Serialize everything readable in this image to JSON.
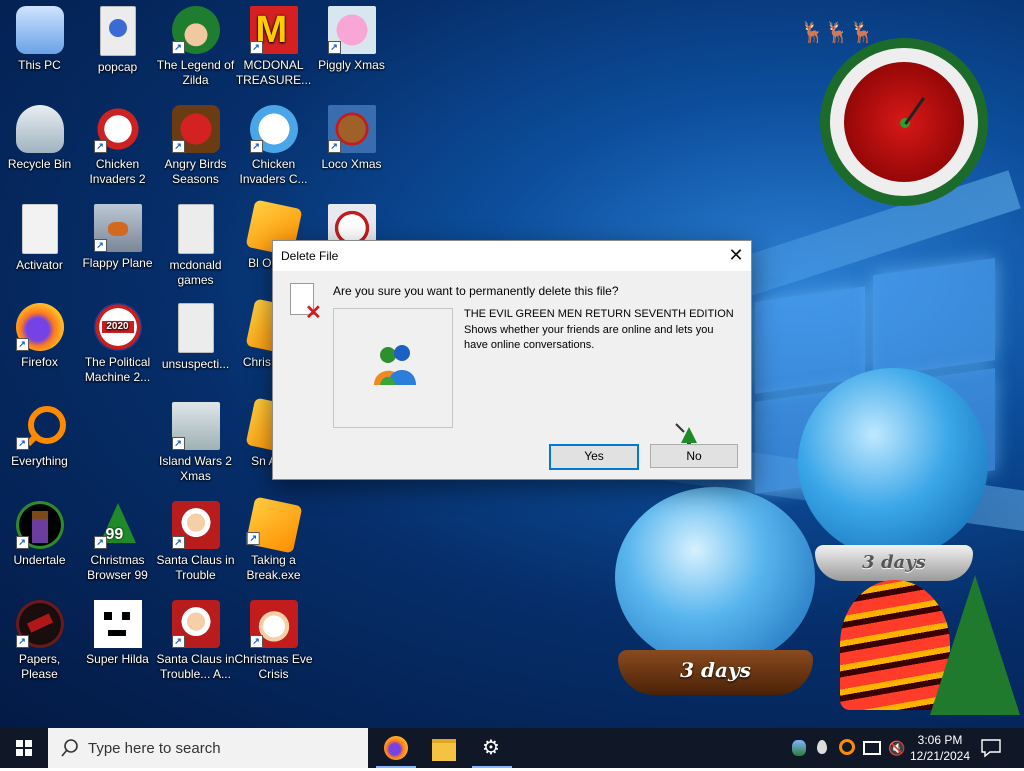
{
  "desktop": {
    "icons": [
      {
        "label": "This PC"
      },
      {
        "label": "popcap"
      },
      {
        "label": "The Legend of Zilda"
      },
      {
        "label": "MCDONAL TREASURE..."
      },
      {
        "label": "Piggly Xmas"
      },
      {
        "label": "Recycle Bin"
      },
      {
        "label": "Chicken Invaders 2"
      },
      {
        "label": "Angry Birds Seasons"
      },
      {
        "label": "Chicken Invaders C..."
      },
      {
        "label": "Loco Xmas"
      },
      {
        "label": "Activator"
      },
      {
        "label": "Flappy Plane"
      },
      {
        "label": "mcdonald games"
      },
      {
        "label": "Bl Ornam"
      },
      {
        "label": "Firefox"
      },
      {
        "label": "The Political Machine 2..."
      },
      {
        "label": "unsuspecti..."
      },
      {
        "label": "Chris Swee"
      },
      {
        "label": "Everything"
      },
      {
        "label": "Island Wars 2 Xmas"
      },
      {
        "label": "Sn Anim"
      },
      {
        "label": "Undertale"
      },
      {
        "label": "Christmas Browser 99"
      },
      {
        "label": "Santa Claus in Trouble"
      },
      {
        "label": "Taking a Break.exe"
      },
      {
        "label": "Papers, Please"
      },
      {
        "label": "Super Hilda"
      },
      {
        "label": "Santa Claus in Trouble... A..."
      },
      {
        "label": "Christmas Eve Crisis"
      }
    ],
    "gadgets": {
      "globe_small_label": "3 days",
      "globe_large_label": "3 days"
    }
  },
  "dialog": {
    "title": "Delete File",
    "question": "Are you sure you want to permanently delete this file?",
    "file_name": "THE EVIL GREEN MEN RETURN SEVENTH EDITION",
    "file_description": "Shows whether your friends are online and lets you have online conversations.",
    "yes_label": "Yes",
    "no_label": "No"
  },
  "taskbar": {
    "search_placeholder": "Type here to search",
    "time": "3:06 PM",
    "date": "12/21/2024"
  }
}
